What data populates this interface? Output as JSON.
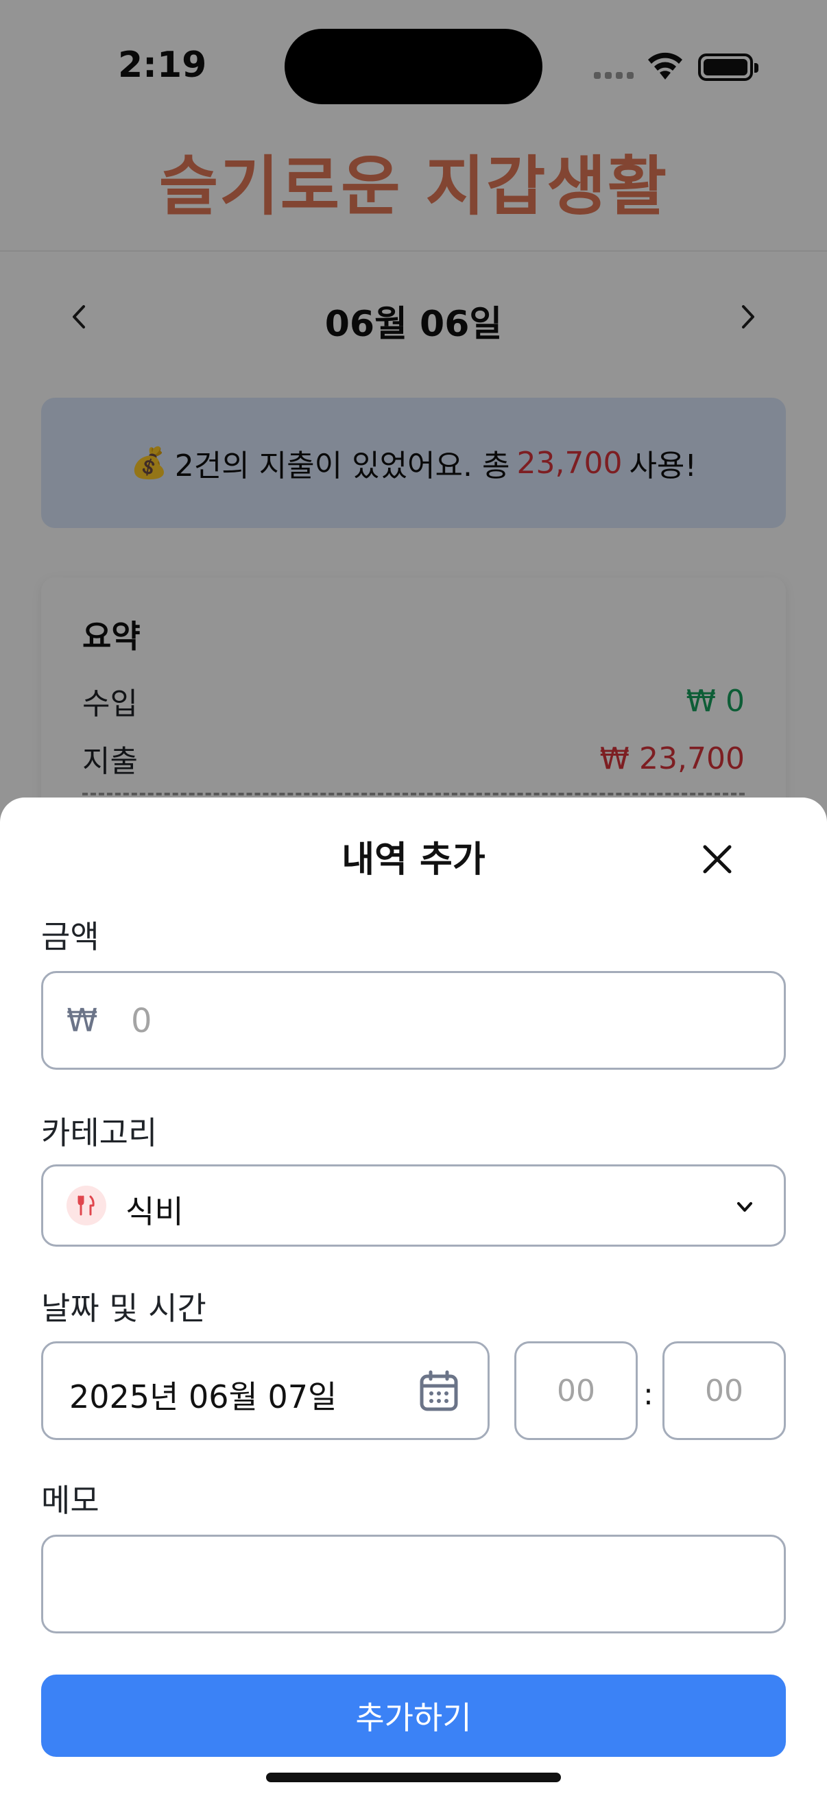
{
  "status_bar": {
    "time": "2:19"
  },
  "header": {
    "title": "슬기로운 지갑생활"
  },
  "date_nav": {
    "prev_icon": "chevron-left-icon",
    "date_label": "06월 06일",
    "next_icon": "chevron-right-icon"
  },
  "banner": {
    "emoji": "💰",
    "text_before": "2건의 지출이 있었어요. 총",
    "amount": "23,700",
    "text_after": "사용!"
  },
  "summary": {
    "title": "요약",
    "income_label": "수입",
    "income_value": "₩ 0",
    "expense_label": "지출",
    "expense_value": "₩ 23,700"
  },
  "sheet": {
    "title": "내역 추가",
    "close_icon": "close-icon",
    "amount_label": "금액",
    "currency_symbol": "₩",
    "amount_placeholder": "0",
    "category_label": "카테고리",
    "category_value": "식비",
    "category_icon": "fork-knife-icon",
    "datetime_label": "날짜 및 시간",
    "date_value": "2025년 06월 07일",
    "hour_placeholder": "00",
    "minute_placeholder": "00",
    "time_separator": ":",
    "memo_label": "메모",
    "memo_value": "",
    "submit_label": "추가하기"
  },
  "colors": {
    "title_accent": "#e07856",
    "income_green": "#18a05d",
    "expense_red": "#d8343c",
    "primary_button": "#3b82f6",
    "banner_bg": "#dbe7fb"
  }
}
